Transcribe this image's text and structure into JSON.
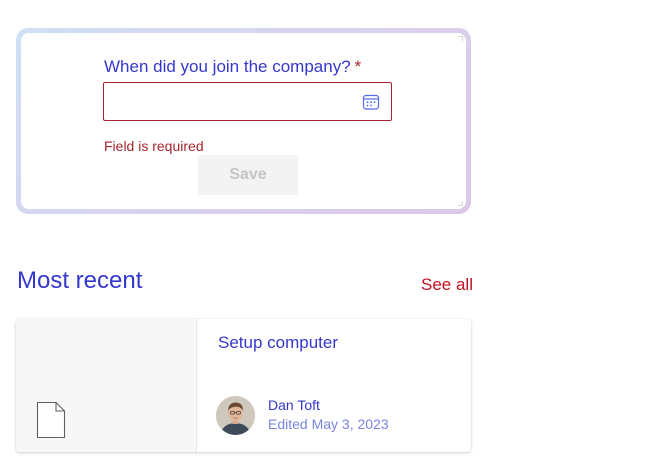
{
  "form": {
    "label": "When did you join the company?",
    "required_mark": "*",
    "date_value": "",
    "error": "Field is required",
    "save_label": "Save",
    "calendar_icon": "calendar-icon"
  },
  "recent": {
    "title": "Most recent",
    "see_all_label": "See all",
    "document": {
      "title": "Setup computer",
      "author": "Dan Toft",
      "edited": "Edited May 3, 2023",
      "file_icon": "document-file-icon"
    }
  },
  "colors": {
    "accent": "#3538cd",
    "error": "#a4262c",
    "link_red": "#c50f1f"
  }
}
